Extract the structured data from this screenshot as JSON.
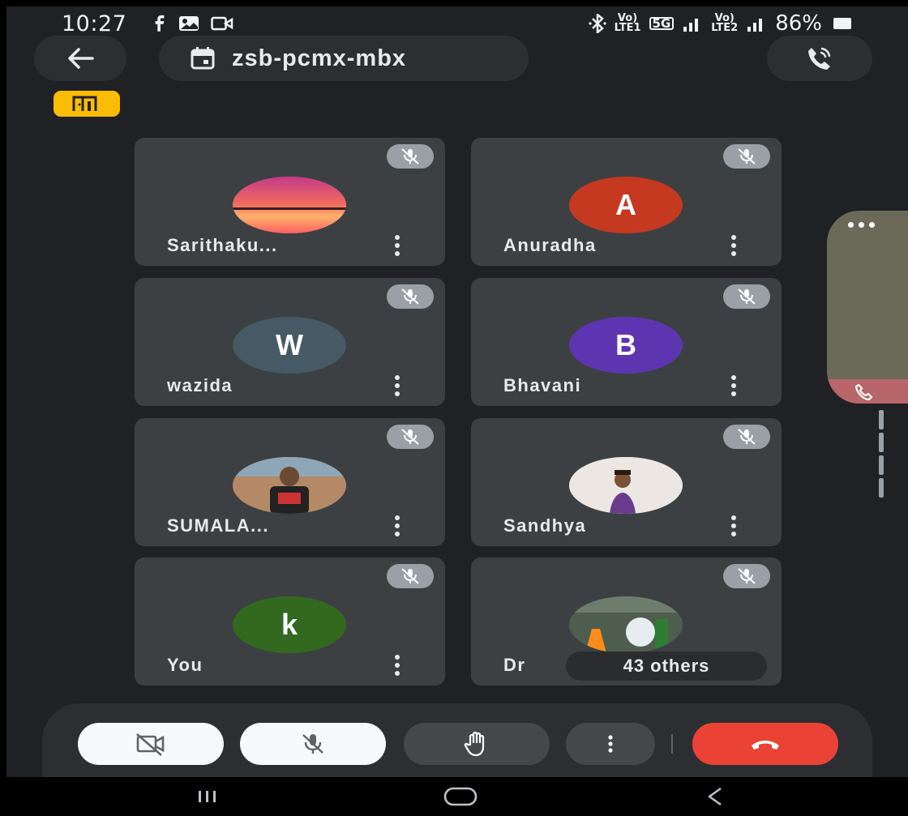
{
  "status_bar": {
    "time": "10:27",
    "battery": "86%",
    "signal_1_top": "Vo)",
    "signal_1_bottom": "LTE1",
    "network": "5G",
    "signal_2_top": "Vo)",
    "signal_2_bottom": "LTE2"
  },
  "header": {
    "meeting_code": "zsb-pcmx-mbx"
  },
  "participants": [
    {
      "name": "Sarithaku...",
      "avatar_type": "photo-sunset",
      "avatar_letter": "",
      "avatar_color": "#e8627a"
    },
    {
      "name": "Anuradha",
      "avatar_type": "letter",
      "avatar_letter": "A",
      "avatar_color": "#c53920"
    },
    {
      "name": "wazida",
      "avatar_type": "letter",
      "avatar_letter": "W",
      "avatar_color": "#455a64"
    },
    {
      "name": "Bhavani",
      "avatar_type": "letter",
      "avatar_letter": "B",
      "avatar_color": "#5e35b1"
    },
    {
      "name": "SUMALA...",
      "avatar_type": "photo-boy",
      "avatar_letter": "",
      "avatar_color": "#a47a5c"
    },
    {
      "name": "Sandhya",
      "avatar_type": "photo-woman",
      "avatar_letter": "",
      "avatar_color": "#e9e4df"
    },
    {
      "name": "You",
      "avatar_type": "letter",
      "avatar_letter": "k",
      "avatar_color": "#33691e"
    },
    {
      "name": "Dr",
      "avatar_type": "photo-lab",
      "avatar_letter": "",
      "avatar_color": "#5b6b5a"
    }
  ],
  "others_label": "43 others",
  "colors": {
    "background": "#202124",
    "tile": "#3c4043",
    "end_call": "#ea4335",
    "exit_badge": "#fbbc04"
  },
  "controls": {
    "camera_icon": "camera-off-icon",
    "mic_icon": "mic-off-icon",
    "hand_icon": "raise-hand-icon",
    "more_icon": "more-vert-icon",
    "end_icon": "call-end-icon"
  }
}
